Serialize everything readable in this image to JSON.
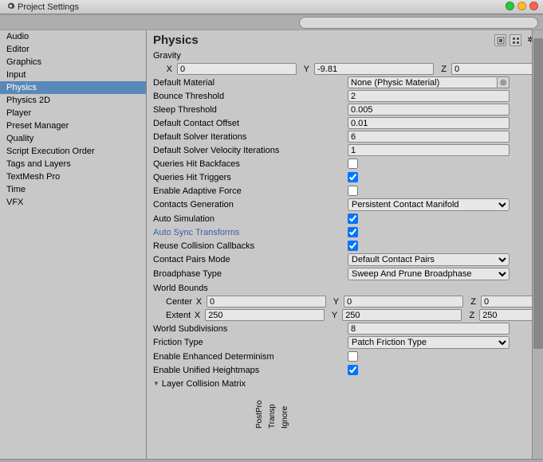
{
  "window": {
    "title": "Project Settings"
  },
  "search": {
    "placeholder": ""
  },
  "sidebar": {
    "items": [
      {
        "label": "Audio",
        "selected": false
      },
      {
        "label": "Editor",
        "selected": false
      },
      {
        "label": "Graphics",
        "selected": false
      },
      {
        "label": "Input",
        "selected": false
      },
      {
        "label": "Physics",
        "selected": true
      },
      {
        "label": "Physics 2D",
        "selected": false
      },
      {
        "label": "Player",
        "selected": false
      },
      {
        "label": "Preset Manager",
        "selected": false
      },
      {
        "label": "Quality",
        "selected": false
      },
      {
        "label": "Script Execution Order",
        "selected": false
      },
      {
        "label": "Tags and Layers",
        "selected": false
      },
      {
        "label": "TextMesh Pro",
        "selected": false
      },
      {
        "label": "Time",
        "selected": false
      },
      {
        "label": "VFX",
        "selected": false
      }
    ]
  },
  "main": {
    "title": "Physics",
    "gravity": {
      "label": "Gravity",
      "x": "0",
      "y": "-9.81",
      "z": "0",
      "ax_x": "X",
      "ax_y": "Y",
      "ax_z": "Z"
    },
    "default_material": {
      "label": "Default Material",
      "value": "None (Physic Material)"
    },
    "bounce_threshold": {
      "label": "Bounce Threshold",
      "value": "2"
    },
    "sleep_threshold": {
      "label": "Sleep Threshold",
      "value": "0.005"
    },
    "default_contact_offset": {
      "label": "Default Contact Offset",
      "value": "0.01"
    },
    "default_solver_iterations": {
      "label": "Default Solver Iterations",
      "value": "6"
    },
    "default_solver_velocity_iterations": {
      "label": "Default Solver Velocity Iterations",
      "value": "1"
    },
    "queries_hit_backfaces": {
      "label": "Queries Hit Backfaces",
      "value": false
    },
    "queries_hit_triggers": {
      "label": "Queries Hit Triggers",
      "value": true
    },
    "enable_adaptive_force": {
      "label": "Enable Adaptive Force",
      "value": false
    },
    "contacts_generation": {
      "label": "Contacts Generation",
      "value": "Persistent Contact Manifold"
    },
    "auto_simulation": {
      "label": "Auto Simulation",
      "value": true
    },
    "auto_sync_transforms": {
      "label": "Auto Sync Transforms",
      "value": true
    },
    "reuse_collision_callbacks": {
      "label": "Reuse Collision Callbacks",
      "value": true
    },
    "contact_pairs_mode": {
      "label": "Contact Pairs Mode",
      "value": "Default Contact Pairs"
    },
    "broadphase_type": {
      "label": "Broadphase Type",
      "value": "Sweep And Prune Broadphase"
    },
    "world_bounds": {
      "label": "World Bounds",
      "center": {
        "label": "Center",
        "x": "0",
        "y": "0",
        "z": "0"
      },
      "extent": {
        "label": "Extent",
        "x": "250",
        "y": "250",
        "z": "250"
      },
      "ax_x": "X",
      "ax_y": "Y",
      "ax_z": "Z"
    },
    "world_subdivisions": {
      "label": "World Subdivisions",
      "value": "8"
    },
    "friction_type": {
      "label": "Friction Type",
      "value": "Patch Friction Type"
    },
    "enable_enhanced_determinism": {
      "label": "Enable Enhanced Determinism",
      "value": false
    },
    "enable_unified_heightmaps": {
      "label": "Enable Unified Heightmaps",
      "value": true
    },
    "layer_collision_matrix": {
      "label": "Layer Collision Matrix",
      "columns": [
        "PostPro",
        "Transp",
        "Ignore"
      ]
    }
  }
}
